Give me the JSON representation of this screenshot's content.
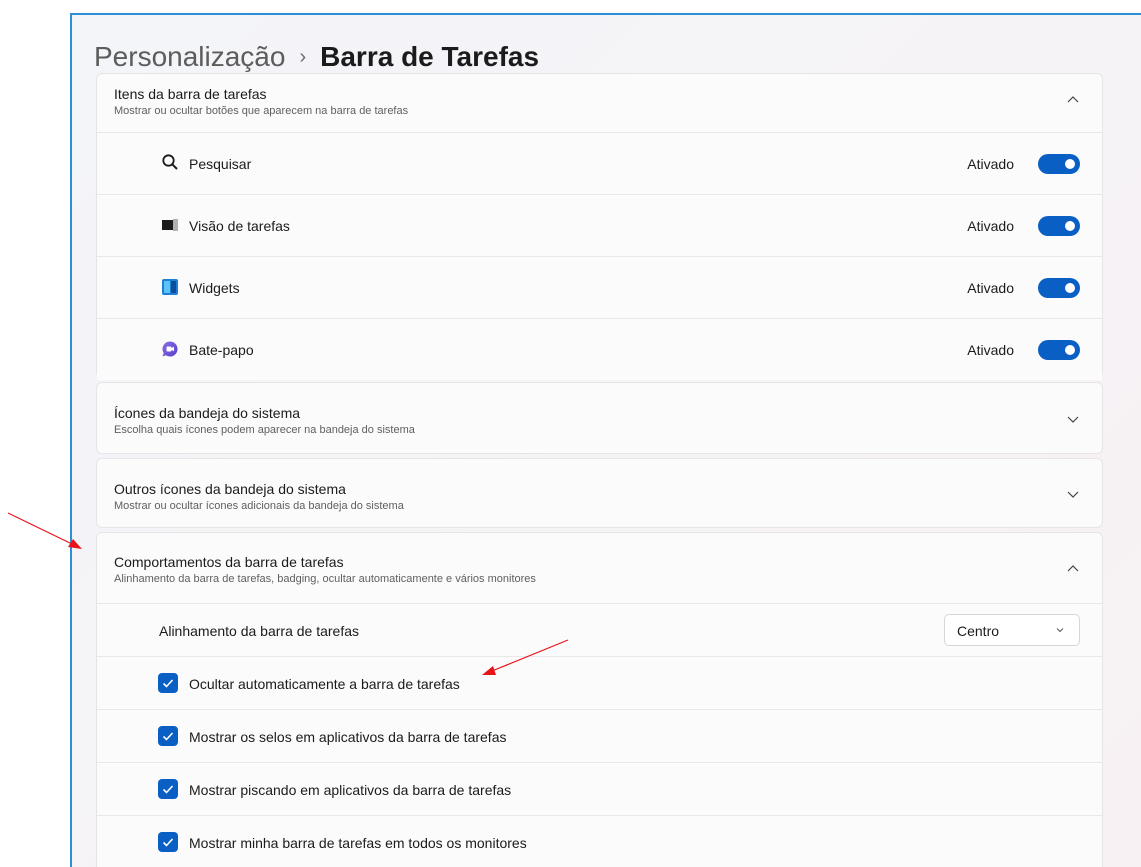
{
  "breadcrumb": {
    "parent": "Personalização",
    "separator": "›",
    "current": "Barra de Tarefas"
  },
  "taskbar_items": {
    "title": "Itens da barra de tarefas",
    "subtitle": "Mostrar ou ocultar botões que aparecem na barra de tarefas",
    "expanded": true,
    "items": [
      {
        "label": "Pesquisar",
        "state": "Ativado",
        "icon": "search-icon",
        "on": true
      },
      {
        "label": "Visão de tarefas",
        "state": "Ativado",
        "icon": "task-view-icon",
        "on": true
      },
      {
        "label": "Widgets",
        "state": "Ativado",
        "icon": "widgets-icon",
        "on": true
      },
      {
        "label": "Bate-papo",
        "state": "Ativado",
        "icon": "chat-icon",
        "on": true
      }
    ]
  },
  "system_tray": {
    "title": "Ícones da bandeja do sistema",
    "subtitle": "Escolha quais ícones podem aparecer na bandeja do sistema",
    "expanded": false
  },
  "other_tray": {
    "title": "Outros ícones da bandeja do sistema",
    "subtitle": "Mostrar ou ocultar ícones adicionais da bandeja do sistema",
    "expanded": false
  },
  "behaviors": {
    "title": "Comportamentos da barra de tarefas",
    "subtitle": "Alinhamento da barra de tarefas, badging, ocultar automaticamente e vários monitores",
    "expanded": true,
    "alignment": {
      "label": "Alinhamento da barra de tarefas",
      "value": "Centro"
    },
    "options": [
      {
        "label": "Ocultar automaticamente a barra de tarefas",
        "checked": true
      },
      {
        "label": "Mostrar os selos em aplicativos da barra de tarefas",
        "checked": true
      },
      {
        "label": "Mostrar piscando em aplicativos da barra de tarefas",
        "checked": true
      },
      {
        "label": "Mostrar minha barra de tarefas em todos os monitores",
        "checked": true
      }
    ]
  },
  "colors": {
    "accent": "#0a5fc4",
    "window_border": "#2d8fd5",
    "annotation_arrow": "#e8141c"
  }
}
